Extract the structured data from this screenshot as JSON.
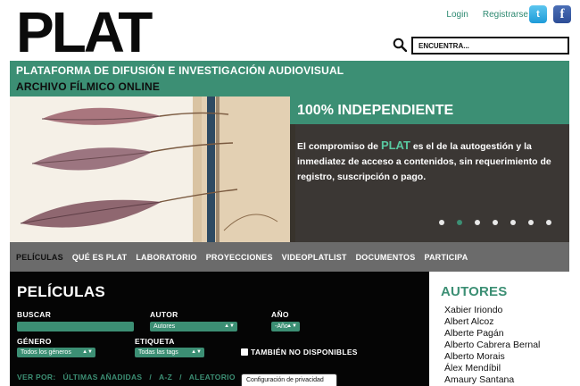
{
  "header": {
    "logo": "PLAT",
    "login": "Login",
    "register": "Registrarse",
    "twitter_icon": "twitter-icon",
    "facebook_icon": "facebook-icon"
  },
  "search": {
    "placeholder": "ENCUENTRA..."
  },
  "band": {
    "title": "PLATAFORMA DE DIFUSIÓN E INVESTIGACIÓN AUDIOVISUAL",
    "subtitle": "ARCHIVO FÍLMICO ONLINE"
  },
  "hero": {
    "headline": "100% INDEPENDIENTE",
    "text_before": "El compromiso de ",
    "plat_word": "PLAT",
    "text_after": " es el de la autogestión y la inmediatez de acceso a contenidos, sin requerimiento de registro, suscripción o pago.",
    "slide_count": 7,
    "active_slide": 2
  },
  "nav": {
    "items": [
      "PELÍCULAS",
      "QUÉ ES PLAT",
      "LABORATORIO",
      "PROYECCIONES",
      "VIDEOPLATLIST",
      "DOCUMENTOS",
      "PARTICIPA"
    ]
  },
  "peliculas": {
    "title": "PELÍCULAS",
    "buscar_label": "BUSCAR",
    "autor_label": "AUTOR",
    "autor_value": "Autores",
    "anio_label": "AÑO",
    "anio_value": "-Año",
    "genero_label": "GÉNERO",
    "genero_value": "Todos los géneros",
    "etiqueta_label": "ETIQUETA",
    "etiqueta_value": "Todas las tags",
    "no_disponibles_label": "TAMBIÉN NO DISPONIBLES",
    "ver_por": "VER POR:",
    "ultimas": "ÚLTIMAS AÑADIDAS",
    "sep": "/",
    "az": "A-Z",
    "aleatorio": "ALEATORIO",
    "privacy": "Configuración de privacidad"
  },
  "autores": {
    "title": "AUTORES",
    "list": [
      "Xabier Iriondo",
      "Albert Alcoz",
      "Alberte Pagán",
      "Alberto Cabrera Bernal",
      "Alberto Morais",
      "Álex Mendíbil",
      "Amaury Santana"
    ]
  },
  "colors": {
    "accent": "#3c8f74",
    "nav_bg": "#6b6b6b",
    "panel_bg": "#050505"
  }
}
